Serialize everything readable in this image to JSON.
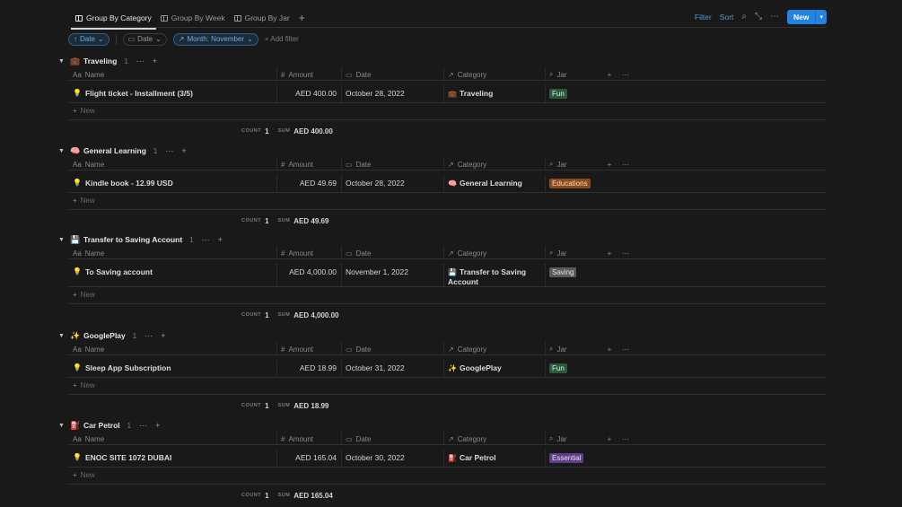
{
  "tabs": [
    {
      "label": "Group By Category",
      "active": true
    },
    {
      "label": "Group By Week",
      "active": false
    },
    {
      "label": "Group By Jar",
      "active": false
    }
  ],
  "toolbar": {
    "filter": "Filter",
    "sort": "Sort",
    "new": "New"
  },
  "filters": {
    "sort_pill": "Date",
    "date_pill": "Date",
    "month_pill": "Month: November",
    "add_filter": "Add filter"
  },
  "columns": {
    "name": "Name",
    "amount": "Amount",
    "date": "Date",
    "category": "Category",
    "jar": "Jar"
  },
  "column_icons": {
    "name": "Aa",
    "amount": "#",
    "date": "calendar-icon",
    "category": "relation-arrow-icon",
    "jar": "search-icon"
  },
  "new_row_label": "New",
  "count_label": "COUNT",
  "sum_label": "SUM",
  "groups": [
    {
      "title": "Traveling",
      "emoji": "💼",
      "count": "1",
      "rows": [
        {
          "name": "Flight ticket - Installment (3/5)",
          "amount": "AED 400.00",
          "date": "October 28, 2022",
          "category": "Traveling",
          "category_emoji": "💼",
          "jar": "Fun",
          "jar_color": "#2b593f",
          "jar_text": "#d8f0e0"
        }
      ],
      "summary": {
        "count": "1",
        "sum": "AED 400.00"
      }
    },
    {
      "title": "General Learning",
      "emoji": "🧠",
      "count": "1",
      "rows": [
        {
          "name": "Kindle book - 12.99 USD",
          "amount": "AED 49.69",
          "date": "October 28, 2022",
          "category": "General Learning",
          "category_emoji": "🧠",
          "jar": "Educations",
          "jar_color": "#8a4a1c",
          "jar_text": "#f3d9c2"
        }
      ],
      "summary": {
        "count": "1",
        "sum": "AED 49.69"
      }
    },
    {
      "title": "Transfer to Saving Account",
      "emoji": "💾",
      "count": "1",
      "rows": [
        {
          "name": "To Saving account",
          "amount": "AED 4,000.00",
          "date": "November 1, 2022",
          "category": "Transfer to Saving Account",
          "category_emoji": "💾",
          "jar": "Saving",
          "jar_color": "#5a5a5a",
          "jar_text": "#e0e0e0"
        }
      ],
      "summary": {
        "count": "1",
        "sum": "AED 4,000.00"
      }
    },
    {
      "title": "GooglePlay",
      "emoji": "✨",
      "count": "1",
      "rows": [
        {
          "name": "Sleep App Subscription",
          "amount": "AED 18.99",
          "date": "October 31, 2022",
          "category": "GooglePlay",
          "category_emoji": "✨",
          "jar": "Fun",
          "jar_color": "#2b593f",
          "jar_text": "#d8f0e0"
        }
      ],
      "summary": {
        "count": "1",
        "sum": "AED 18.99"
      }
    },
    {
      "title": "Car Petrol",
      "emoji": "⛽",
      "count": "1",
      "rows": [
        {
          "name": "ENOC SITE 1072 DUBAI",
          "amount": "AED 165.04",
          "date": "October 30, 2022",
          "category": "Car Petrol",
          "category_emoji": "⛽",
          "jar": "Essential",
          "jar_color": "#5e3f86",
          "jar_text": "#eadcf8"
        }
      ],
      "summary": {
        "count": "1",
        "sum": "AED 165.04"
      }
    }
  ]
}
